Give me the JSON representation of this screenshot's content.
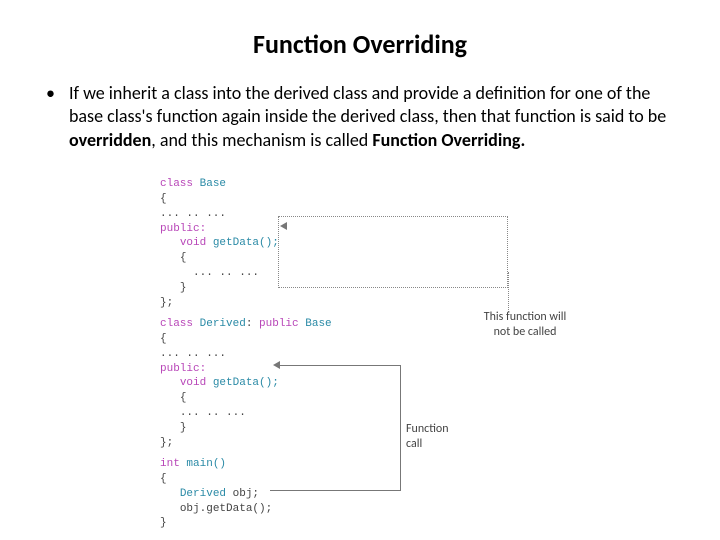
{
  "title": "Function Overriding",
  "bullet_prefix": "If we inherit a class into the derived class and provide a definition for one of the base class's function again inside the derived class, then that function is said to be ",
  "bullet_bold1": "overridden",
  "bullet_mid": ", and this mechanism is called ",
  "bullet_bold2": "Function Overriding.",
  "code": {
    "base1": "class",
    "base1b": " Base",
    "brace_o": "{",
    "dots": "... .. ...",
    "public": "public:",
    "void": "void",
    "getData": " getData();",
    "brace_c": "}",
    "semicolon": "};",
    "derived1": "class",
    "derived1b": " Derived",
    "derived1c": ": ",
    "derived1d": "public",
    "derived1e": " Base",
    "intmain": "int",
    "main": " main()",
    "derived_obj_a": "Derived",
    "derived_obj_b": " obj;",
    "call": "obj.getData();"
  },
  "annot1": "This function\nwill not be\ncalled",
  "annot2": "Function\ncall"
}
